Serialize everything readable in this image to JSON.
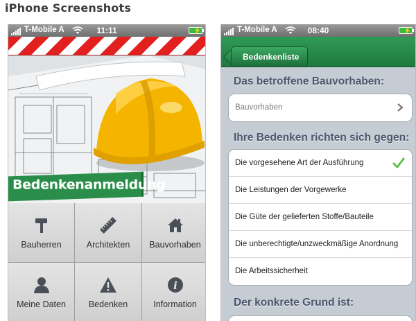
{
  "page": {
    "title": "iPhone Screenshots"
  },
  "left_phone": {
    "status": {
      "carrier": "T-Mobile A",
      "time": "11:11"
    },
    "brand_banner": "Bedenkenanmeldung",
    "tiles": [
      {
        "label": "Bauherren",
        "icon": "hammer-icon"
      },
      {
        "label": "Architekten",
        "icon": "ruler-icon"
      },
      {
        "label": "Bauvorhaben",
        "icon": "house-icon"
      },
      {
        "label": "Meine Daten",
        "icon": "person-icon"
      },
      {
        "label": "Bedenken",
        "icon": "warning-icon"
      },
      {
        "label": "Information",
        "icon": "info-icon"
      }
    ]
  },
  "right_phone": {
    "status": {
      "carrier": "T-Mobile A",
      "time": "08:40"
    },
    "nav": {
      "back_label": "Bedenkenliste"
    },
    "section1": {
      "header": "Das betroffene Bauvorhaben:",
      "field_placeholder": "Bauvorhaben"
    },
    "section2": {
      "header": "Ihre Bedenken richten sich gegen:",
      "options": [
        {
          "label": "Die vorgesehene Art der Ausführung",
          "checked": true
        },
        {
          "label": "Die Leistungen der Vorgewerke",
          "checked": false
        },
        {
          "label": "Die Güte der gelieferten Stoffe/Bauteile",
          "checked": false
        },
        {
          "label": "Die unberechtigte/unzweckmäßige Anordnung",
          "checked": false
        },
        {
          "label": "Die Arbeitssicherheit",
          "checked": false
        }
      ]
    },
    "section3": {
      "header": "Der konkrete Grund ist:"
    }
  },
  "colors": {
    "brand_green": "#2a8e4a",
    "check_green": "#5fbf4a",
    "stripe_red": "#e32020"
  }
}
